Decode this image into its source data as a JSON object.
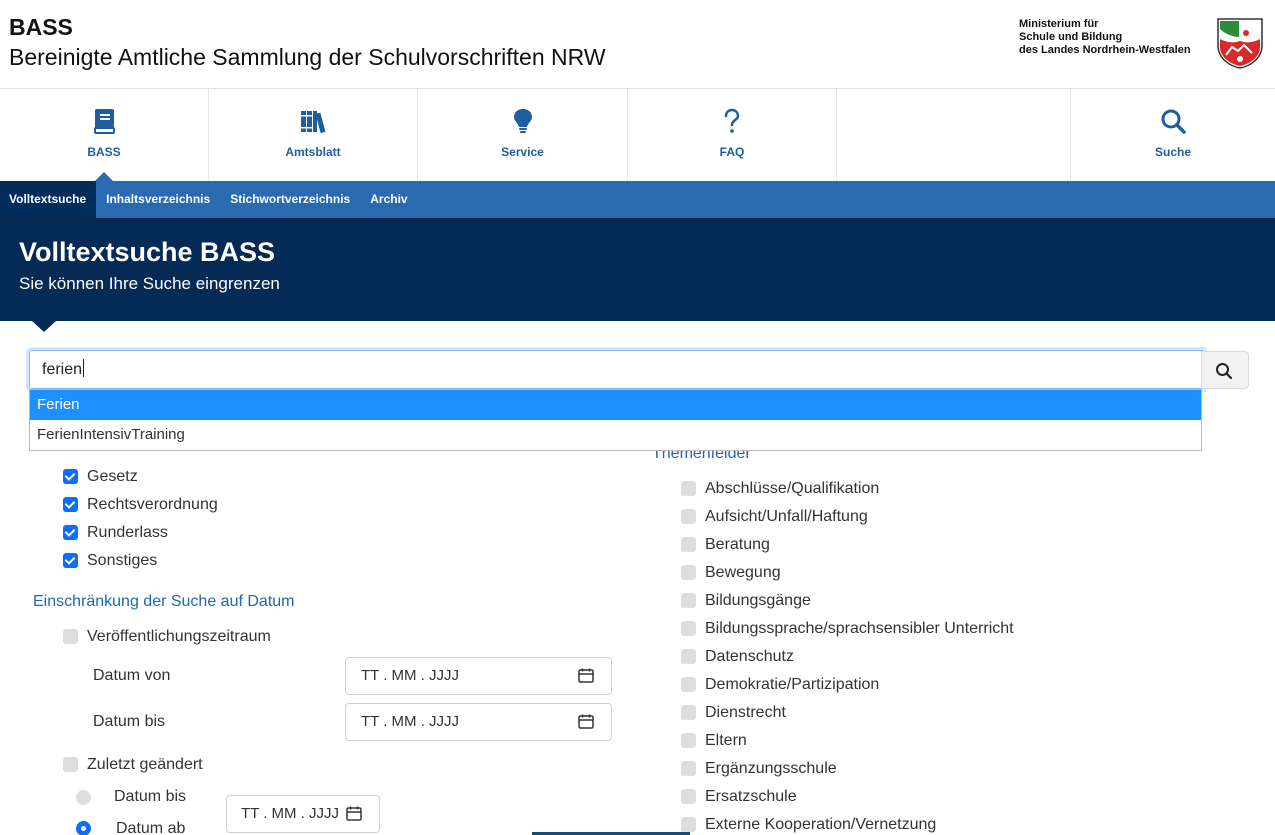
{
  "header": {
    "brand_short": "BASS",
    "brand_long": "Bereinigte Amtliche Sammlung der Schulvorschriften NRW",
    "ministry_line1": "Ministerium für",
    "ministry_line2": "Schule und Bildung",
    "ministry_line3": "des Landes Nordrhein-Westfalen",
    "crest_icon": "nrw-coat-of-arms-icon"
  },
  "mainnav": {
    "items": [
      {
        "label": "BASS",
        "icon": "book-icon"
      },
      {
        "label": "Amtsblatt",
        "icon": "books-icon"
      },
      {
        "label": "Service",
        "icon": "lightbulb-icon"
      },
      {
        "label": "FAQ",
        "icon": "question-icon"
      },
      {
        "label": "",
        "icon": ""
      },
      {
        "label": "Suche",
        "icon": "search-icon"
      }
    ]
  },
  "subnav": {
    "tabs": [
      "Volltextsuche",
      "Inhaltsverzeichnis",
      "Stichwortverzeichnis",
      "Archiv"
    ]
  },
  "banner": {
    "title": "Volltextsuche BASS",
    "subtitle": "Sie können Ihre Suche eingrenzen"
  },
  "search": {
    "value": "ferien",
    "suggestions": [
      "Ferien",
      "FerienIntensivTraining"
    ]
  },
  "filters": {
    "types": [
      {
        "label": "Gesetz",
        "checked": true
      },
      {
        "label": "Rechtsverordnung",
        "checked": true
      },
      {
        "label": "Runderlass",
        "checked": true
      },
      {
        "label": "Sonstiges",
        "checked": true
      }
    ],
    "date_section_title": "Einschränkung der Suche auf Datum",
    "publication_period_label": "Veröffentlichungszeitraum",
    "date_from_label": "Datum von",
    "date_to_label": "Datum bis",
    "date_placeholder": "TT . MM . JJJJ",
    "last_changed_label": "Zuletzt geändert",
    "radio_before_label": "Datum bis",
    "radio_after_label": "Datum ab"
  },
  "themes": {
    "title": "Themenfelder",
    "items": [
      "Abschlüsse/Qualifikation",
      "Aufsicht/Unfall/Haftung",
      "Beratung",
      "Bewegung",
      "Bildungsgänge",
      "Bildungssprache/sprachsensibler Unterricht",
      "Datenschutz",
      "Demokratie/Partizipation",
      "Dienstrecht",
      "Eltern",
      "Ergänzungsschule",
      "Ersatzschule",
      "Externe Kooperation/Vernetzung"
    ]
  },
  "colors": {
    "accent": "#2a6ab0",
    "banner": "#062a56",
    "checkbox_on": "#0d6efd",
    "suggestion_selected": "#1e90ff"
  }
}
